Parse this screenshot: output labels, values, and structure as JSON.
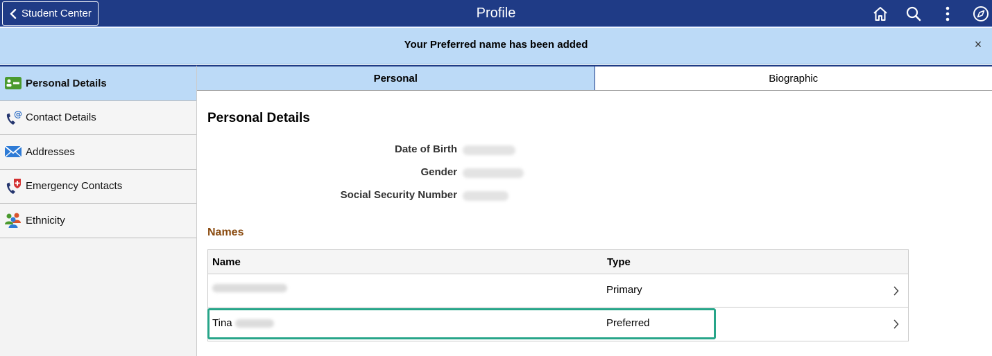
{
  "header": {
    "back_label": "Student Center",
    "title": "Profile",
    "icons": [
      "home-icon",
      "search-icon",
      "more-vertical-icon",
      "compass-icon"
    ]
  },
  "banner": {
    "message": "Your Preferred name has been added",
    "close_symbol": "×"
  },
  "sidebar": {
    "items": [
      {
        "label": "Personal Details",
        "icon": "id-card-icon"
      },
      {
        "label": "Contact Details",
        "icon": "phone-at-icon"
      },
      {
        "label": "Addresses",
        "icon": "envelope-icon"
      },
      {
        "label": "Emergency Contacts",
        "icon": "phone-medical-icon"
      },
      {
        "label": "Ethnicity",
        "icon": "people-icon"
      }
    ]
  },
  "tabs": [
    {
      "label": "Personal"
    },
    {
      "label": "Biographic"
    }
  ],
  "personal": {
    "title": "Personal Details",
    "fields": [
      {
        "label": "Date of Birth"
      },
      {
        "label": "Gender"
      },
      {
        "label": "Social Security Number"
      }
    ]
  },
  "names": {
    "title": "Names",
    "columns": [
      "Name",
      "Type"
    ],
    "rows": [
      {
        "name": "",
        "type": "Primary"
      },
      {
        "name": "Tina",
        "type": "Preferred"
      }
    ]
  },
  "colors": {
    "header_bg": "#1f3b86",
    "banner_bg": "#bcdaf7",
    "names_title": "#8a4b10",
    "highlight": "#27a589"
  }
}
